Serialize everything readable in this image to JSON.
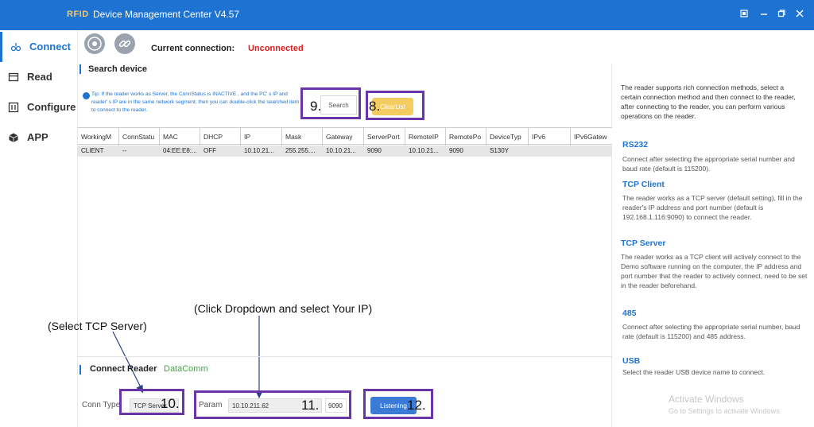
{
  "titlebar": {
    "logo": "RFID",
    "title": "Device Management Center V4.57",
    "controls": [
      "restore-icon",
      "minimize-icon",
      "maximize-icon",
      "close-icon"
    ]
  },
  "sidebar": {
    "items": [
      {
        "label": "Connect",
        "icon": "plug-icon",
        "active": true
      },
      {
        "label": "Read",
        "icon": "card-icon",
        "active": false
      },
      {
        "label": "Configure",
        "icon": "sliders-icon",
        "active": false
      },
      {
        "label": "APP",
        "icon": "cube-icon",
        "active": false
      }
    ]
  },
  "topbar": {
    "current_label": "Current connection:",
    "current_value": "Unconnected"
  },
  "search_section": {
    "title": "Search device",
    "tip": "Tip: If the reader works as Server, the ConnStatus is INACTIVE , and the PC' s IP and reader' s IP are in the same network segment, then you can double-click the searched item to connect to the reader.",
    "search_label": "Search",
    "clear_label": "ClearList",
    "callout_search": "9.",
    "callout_clear": "8."
  },
  "table": {
    "headers": [
      "WorkingM",
      "ConnStatu",
      "MAC",
      "DHCP",
      "IP",
      "Mask",
      "Gateway",
      "ServerPort",
      "RemoteIP",
      "RemotePo",
      "DeviceTyp",
      "IPv6",
      "IPv6Gatew"
    ],
    "rows": [
      [
        "CLIENT",
        "--",
        "04:EE:E8:...",
        "OFF",
        "10.10.21...",
        "255.255....",
        "10.10.21...",
        "9090",
        "10.10.21...",
        "9090",
        "S130Y",
        "",
        ""
      ]
    ]
  },
  "annotations": {
    "dropdown": "(Click Dropdown and select Your IP)",
    "tcp": "(Select TCP Server)"
  },
  "connect_section": {
    "title": "Connect Reader",
    "tab": "DataComm",
    "conn_type_label": "Conn Type",
    "conn_type_value": "TCP Server",
    "param_label": "Param",
    "param_value": "10.10.211.62",
    "port_value": "9090",
    "listen_label": "Listening",
    "callout_conn": "10.",
    "callout_param": "11.",
    "callout_listen": "12."
  },
  "help": {
    "intro": "The reader supports rich connection methods, select a certain connection method and then connect to the reader, after connecting to the reader, you can perform various operations on the reader.",
    "sections": [
      {
        "title": "RS232",
        "body": "Connect after selecting the appropriate serial number and baud rate (default is 115200)."
      },
      {
        "title": "TCP Client",
        "body": "The reader works as a TCP server (default setting), fill in the reader's IP address and port number (default is 192.168.1.116:9090) to connect the reader."
      },
      {
        "title": "TCP Server",
        "body": "The reader works as a TCP client will actively connect to the Demo software running on the computer, the IP address and port number that the reader to actively connect, need  to be set in the reader beforehand."
      },
      {
        "title": "485",
        "body": "Connect after selecting the appropriate serial number, baud rate (default is 115200) and 485 address."
      },
      {
        "title": "USB",
        "body": "Select the reader USB device name to connect."
      }
    ],
    "watermark_title": "Activate Windows",
    "watermark_sub": "Go to Settings to activate Windows."
  },
  "colors": {
    "accent": "#1e73d2",
    "danger": "#e02020",
    "callout": "#6a35a8",
    "clear_button": "#f5cc60",
    "listen_button": "#3a7bd5",
    "datacomm": "#4aa34a"
  }
}
